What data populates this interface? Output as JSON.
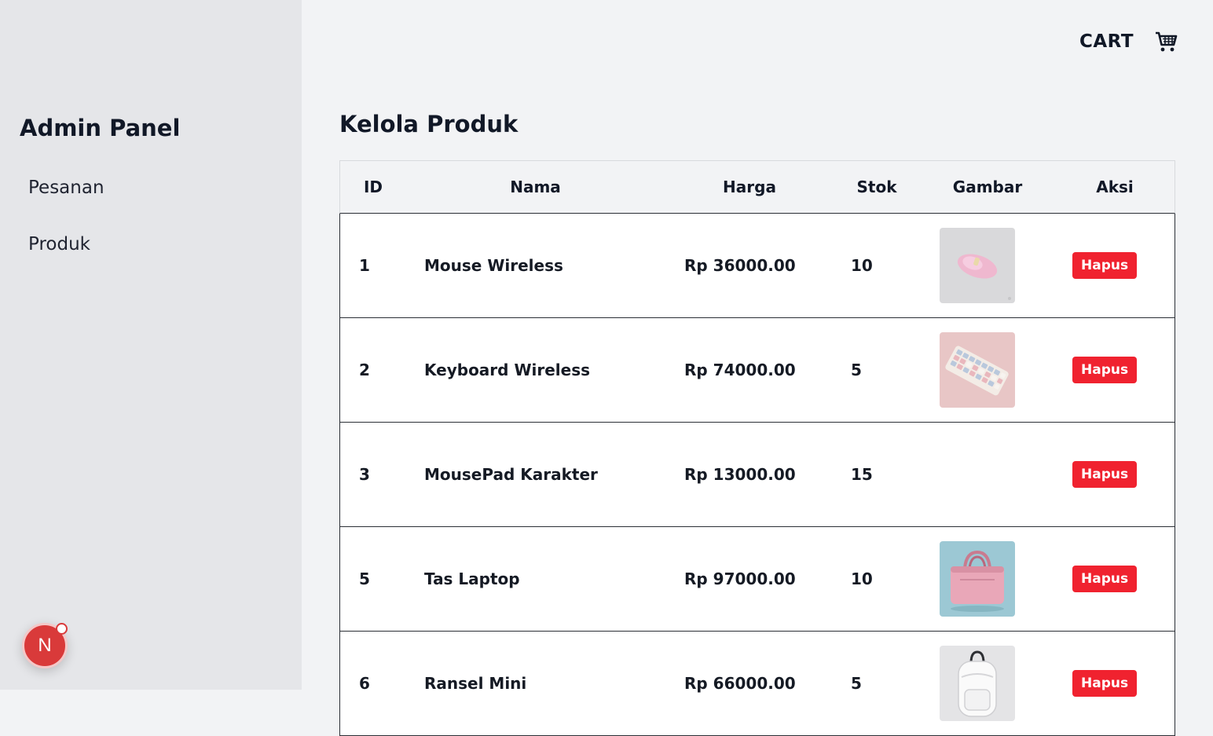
{
  "sidebar": {
    "title": "Admin Panel",
    "items": [
      {
        "label": "Pesanan"
      },
      {
        "label": "Produk"
      }
    ]
  },
  "header": {
    "cart_label": "CART",
    "cart_icon": "shopping-cart-icon"
  },
  "main": {
    "title": "Kelola Produk",
    "columns": [
      "ID",
      "Nama",
      "Harga",
      "Stok",
      "Gambar",
      "Aksi"
    ],
    "rows": [
      {
        "id": "1",
        "name": "Mouse Wireless",
        "price": "Rp 36000.00",
        "stock": "10",
        "image": "pink-wireless-mouse",
        "action": "Hapus"
      },
      {
        "id": "2",
        "name": "Keyboard Wireless",
        "price": "Rp 74000.00",
        "stock": "5",
        "image": "pastel-keyboard",
        "action": "Hapus"
      },
      {
        "id": "3",
        "name": "MousePad Karakter",
        "price": "Rp 13000.00",
        "stock": "15",
        "image": "",
        "action": "Hapus"
      },
      {
        "id": "5",
        "name": "Tas Laptop",
        "price": "Rp 97000.00",
        "stock": "10",
        "image": "pink-laptop-bag",
        "action": "Hapus"
      },
      {
        "id": "6",
        "name": "Ransel Mini",
        "price": "Rp 66000.00",
        "stock": "5",
        "image": "white-backpack",
        "action": "Hapus"
      }
    ]
  },
  "colors": {
    "accent_red": "#f0222f",
    "sidebar_bg": "#e5e6e9",
    "page_bg": "#f2f3f5"
  },
  "dev_badge": {
    "letter": "N"
  }
}
